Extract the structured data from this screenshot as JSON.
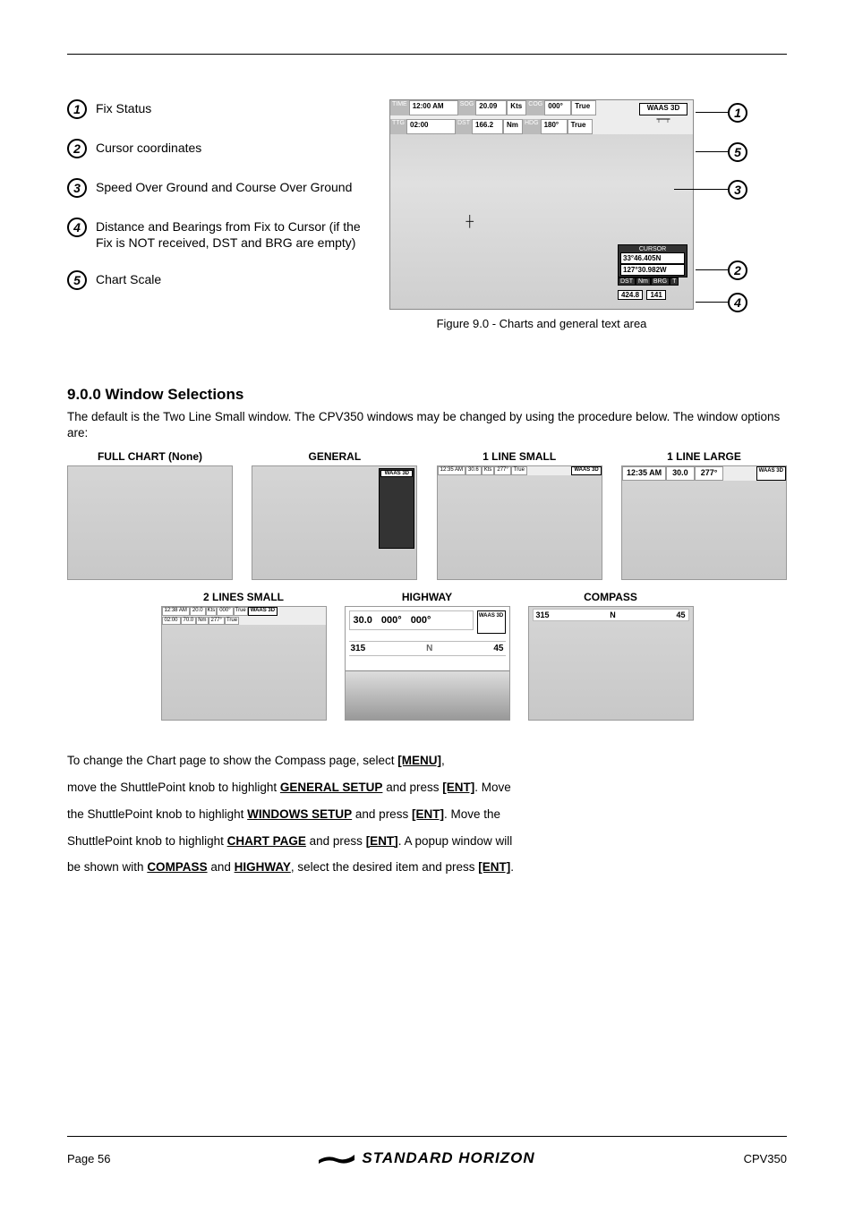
{
  "legend": {
    "i1": "Fix Status",
    "i2": "Cursor coordinates",
    "i3": "Speed Over Ground and Course Over Ground",
    "i4": "Distance and Bearings from Fix to Cursor (if the Fix is NOT received, DST and BRG are empty)",
    "i5": "Chart Scale"
  },
  "fig": {
    "time_lbl": "TIME",
    "time": "12:00 AM",
    "ttg_lbl": "TTG",
    "ttg": "02:00",
    "sog_lbl": "SOG",
    "sog": "20.09",
    "sog_u": "Kts",
    "dst_lbl": "DST",
    "dst": "166.2",
    "dst_u": "Nm",
    "cog_lbl": "COG",
    "cog": "000°",
    "cog_u": "True",
    "hdg_lbl": "HDG",
    "hdg": "180°",
    "hdg_u": "True",
    "waas": "WAAS 3D",
    "cursor_title": "CURSOR",
    "lat": "33°46.405N",
    "lon": "127°30.982W",
    "dstrow_lbl": "DST",
    "dstrow_u": "Nm",
    "brg_lbl": "BRG",
    "brg_u": "T",
    "dst_val": "424.8",
    "brg_val": "141",
    "caption": "Figure 9.0 - Charts and general text area"
  },
  "section": {
    "num": "9.0.0 Window Selections",
    "p1": "The default is the Two Line Small window. The CPV350 windows may be changed by using the procedure below. The window options are:"
  },
  "layouts": {
    "l1": "FULL CHART (None)",
    "l2": "GENERAL",
    "l3": "1 LINE SMALL",
    "l4": "1 LINE LARGE",
    "l5": "2 LINES SMALL",
    "l6": "HIGHWAY",
    "l7": "COMPASS"
  },
  "thumb_l3": {
    "time": "12:35 AM",
    "sog": "30.6",
    "sog_u": "Kts",
    "cog": "277°",
    "cog_u": "True",
    "waas": "WAAS 3D"
  },
  "thumb_l4": {
    "time": "12:35 AM",
    "sog": "30.0",
    "cog": "277°",
    "waas": "WAAS 3D"
  },
  "thumb_l5": {
    "time": "12:38 AM",
    "sog": "20.0",
    "sog_u": "Kts",
    "ttg": "02:00",
    "dst": "70.0",
    "dst_u": "Nm",
    "cog": "000°",
    "cog_u": "True",
    "hdg": "277°",
    "hdg_u": "True",
    "waas": "WAAS 3D"
  },
  "thumb_l6": {
    "sog": "30.0",
    "cog": "000°",
    "brg": "000°",
    "waas": "WAAS 3D",
    "v315": "315",
    "v45": "45"
  },
  "thumb_l7": {
    "v315": "315",
    "v45": "45"
  },
  "change": {
    "line1a": "To change the Chart page to show the Compass page, select ",
    "line1b": "[MENU]",
    "line1c": ",",
    "line2a": "move the ShuttlePoint knob to highlight ",
    "line2b": "GENERAL SETUP",
    "line2c": " and press ",
    "line2d": "[ENT]",
    "line2e": ". Move",
    "line3a": "the ShuttlePoint knob to highlight ",
    "line3b": "WINDOWS SETUP",
    "line3c": " and press ",
    "line3d": "[ENT]",
    "line3e": ". Move the",
    "line4a": "ShuttlePoint knob to highlight ",
    "line4b": "CHART PAGE",
    "line4c": " and press ",
    "line4d": "[ENT]",
    "line4e": ". A popup window will",
    "line5a": "be shown with ",
    "line5b": "COMPASS",
    "line5c": " and ",
    "line5d": "HIGHWAY",
    "line5e": ", select the desired item and press ",
    "line5f": "[ENT]",
    "line5g": "."
  },
  "footer": {
    "page": "Page 56",
    "logo": "STANDARD HORIZON",
    "model": "CPV350"
  }
}
